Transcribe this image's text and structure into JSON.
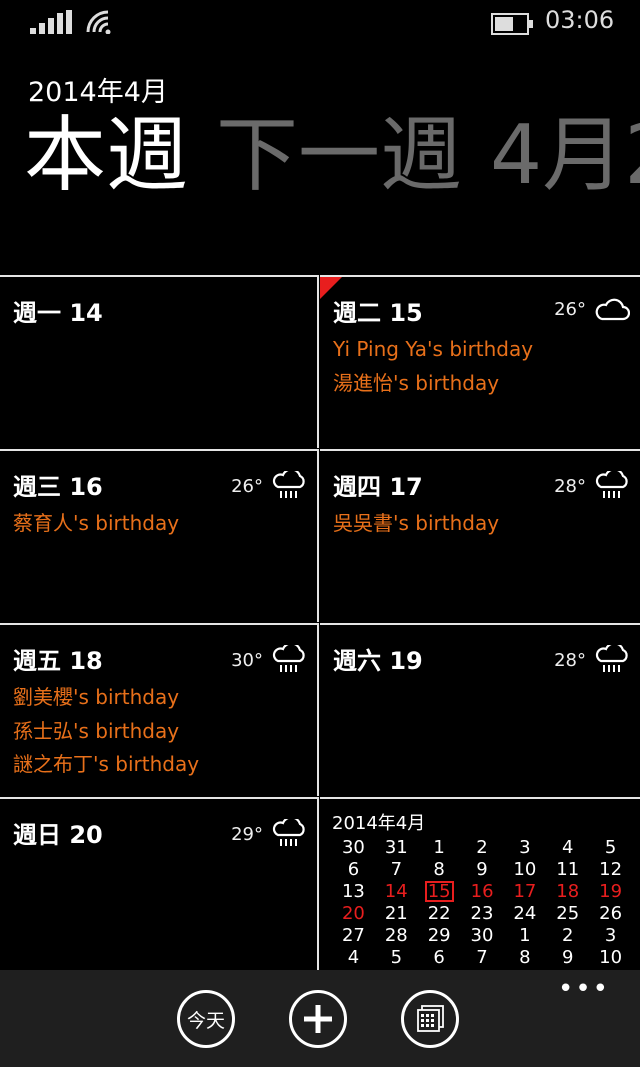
{
  "status_bar": {
    "time": "03:06"
  },
  "header": {
    "month": "2014年4月"
  },
  "pivot": [
    "本週",
    "下一週",
    "4月2"
  ],
  "days": [
    {
      "label": "週一 14",
      "temp": "",
      "weather": "none",
      "events": []
    },
    {
      "label": "週二 15",
      "temp": "26°",
      "weather": "cloud-icon",
      "events": [
        "Yi Ping Ya's birthday",
        "湯進怡's birthday"
      ],
      "today_marker": true
    },
    {
      "label": "週三 16",
      "temp": "26°",
      "weather": "rain-icon",
      "events": [
        "蔡育人's birthday"
      ]
    },
    {
      "label": "週四 17",
      "temp": "28°",
      "weather": "rain-icon",
      "events": [
        "吳吳書's birthday"
      ]
    },
    {
      "label": "週五 18",
      "temp": "30°",
      "weather": "rain-icon",
      "events": [
        "劉美櫻's birthday",
        "孫士弘's birthday",
        "謎之布丁's birthday"
      ]
    },
    {
      "label": "週六 19",
      "temp": "28°",
      "weather": "rain-icon",
      "events": []
    },
    {
      "label": "週日 20",
      "temp": "29°",
      "weather": "rain-icon",
      "events": []
    }
  ],
  "mini_calendar": {
    "title": "2014年4月",
    "rows": [
      [
        "30",
        "31",
        "1",
        "2",
        "3",
        "4",
        "5"
      ],
      [
        "6",
        "7",
        "8",
        "9",
        "10",
        "11",
        "12"
      ],
      [
        "13",
        "14",
        "15",
        "16",
        "17",
        "18",
        "19"
      ],
      [
        "20",
        "21",
        "22",
        "23",
        "24",
        "25",
        "26"
      ],
      [
        "27",
        "28",
        "29",
        "30",
        "1",
        "2",
        "3"
      ],
      [
        "4",
        "5",
        "6",
        "7",
        "8",
        "9",
        "10"
      ]
    ],
    "highlight_color": "#e81e1e"
  },
  "app_bar": {
    "today_label": "今天",
    "more": "•••"
  },
  "colors": {
    "accent": "#e8701a",
    "highlight": "#e81e1e"
  }
}
